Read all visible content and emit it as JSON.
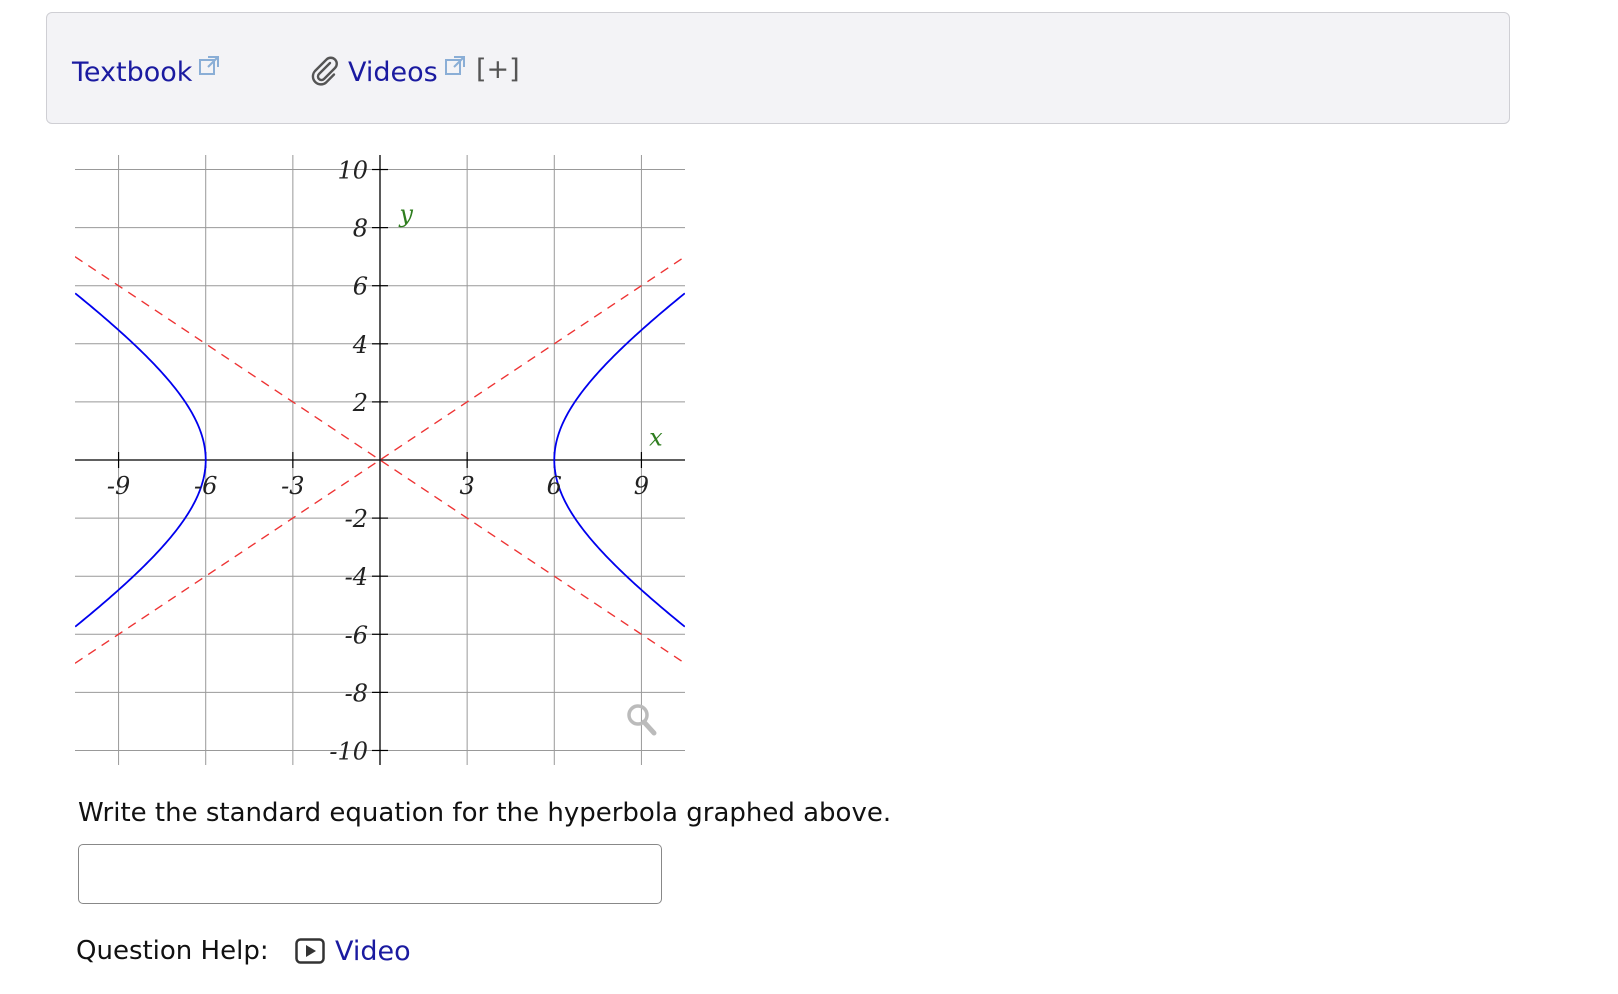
{
  "resources": {
    "textbook_label": "Textbook",
    "videos_label": "Videos",
    "expand_label": "[+]"
  },
  "chart_data": {
    "type": "line",
    "xlim": [
      -10.5,
      10.5
    ],
    "ylim": [
      -10.5,
      10.5
    ],
    "grid": true,
    "xlabel": "x",
    "ylabel": "y",
    "x_ticks": [
      -9,
      -6,
      -3,
      3,
      6,
      9
    ],
    "x_tick_labels": [
      "-9",
      "-6",
      "-3",
      "3",
      "6",
      "9"
    ],
    "y_ticks": [
      10,
      8,
      6,
      4,
      2,
      -2,
      -4,
      -6,
      -8,
      -10
    ],
    "y_tick_labels": [
      "10",
      "8",
      "6",
      "4",
      "2",
      "-2",
      "-4",
      "-6",
      "-8",
      "-10"
    ],
    "hyperbola": {
      "center": [
        0,
        0
      ],
      "a": 6,
      "b": 4,
      "orientation": "horizontal",
      "color": "#0000ee"
    },
    "asymptotes": [
      {
        "slope": 0.6667,
        "intercept": 0,
        "style": "dashed",
        "color": "#ee3333"
      },
      {
        "slope": -0.6667,
        "intercept": 0,
        "style": "dashed",
        "color": "#ee3333"
      }
    ],
    "label_color": "#2e7d1e"
  },
  "question": {
    "prompt": "Write the standard equation for the hyperbola graphed above.",
    "answer_value": "",
    "help_label": "Question Help:",
    "video_label": "Video"
  }
}
